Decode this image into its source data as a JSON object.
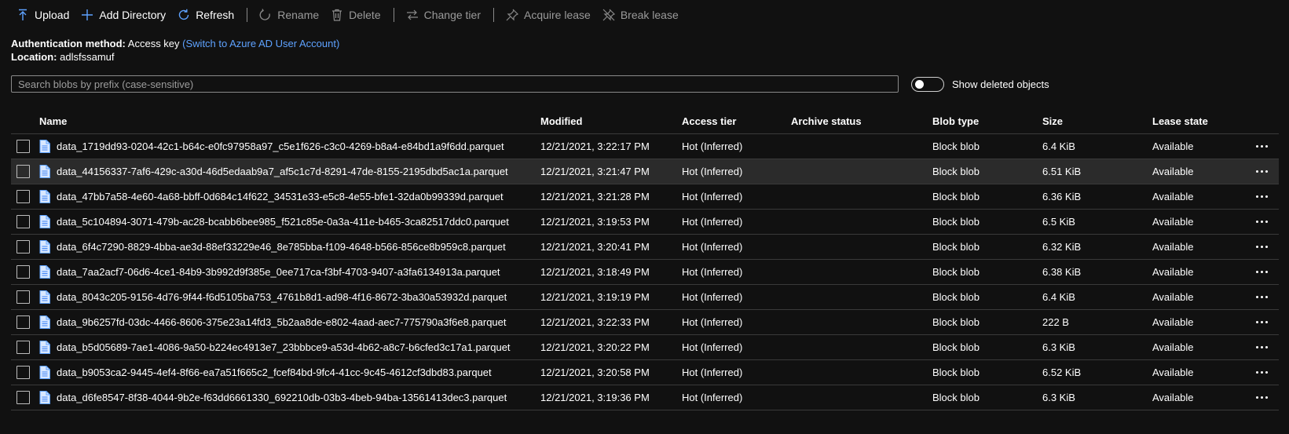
{
  "toolbar": {
    "upload": "Upload",
    "add_directory": "Add Directory",
    "refresh": "Refresh",
    "rename": "Rename",
    "delete": "Delete",
    "change_tier": "Change tier",
    "acquire_lease": "Acquire lease",
    "break_lease": "Break lease"
  },
  "info": {
    "auth_label": "Authentication method:",
    "auth_value": "Access key",
    "auth_link": "(Switch to Azure AD User Account)",
    "location_label": "Location:",
    "location_value": "adlsfssamuf"
  },
  "search": {
    "placeholder": "Search blobs by prefix (case-sensitive)",
    "value": ""
  },
  "show_deleted": {
    "label": "Show deleted objects",
    "on": false
  },
  "columns": {
    "name": "Name",
    "modified": "Modified",
    "access_tier": "Access tier",
    "archive_status": "Archive status",
    "blob_type": "Blob type",
    "size": "Size",
    "lease_state": "Lease state"
  },
  "rows": [
    {
      "name": "data_1719dd93-0204-42c1-b64c-e0fc97958a97_c5e1f626-c3c0-4269-b8a4-e84bd1a9f6dd.parquet",
      "modified": "12/21/2021, 3:22:17 PM",
      "tier": "Hot (Inferred)",
      "archive": "",
      "type": "Block blob",
      "size": "6.4 KiB",
      "lease": "Available"
    },
    {
      "name": "data_44156337-7af6-429c-a30d-46d5edaab9a7_af5c1c7d-8291-47de-8155-2195dbd5ac1a.parquet",
      "modified": "12/21/2021, 3:21:47 PM",
      "tier": "Hot (Inferred)",
      "archive": "",
      "type": "Block blob",
      "size": "6.51 KiB",
      "lease": "Available"
    },
    {
      "name": "data_47bb7a58-4e60-4a68-bbff-0d684c14f622_34531e33-e5c8-4e55-bfe1-32da0b99339d.parquet",
      "modified": "12/21/2021, 3:21:28 PM",
      "tier": "Hot (Inferred)",
      "archive": "",
      "type": "Block blob",
      "size": "6.36 KiB",
      "lease": "Available"
    },
    {
      "name": "data_5c104894-3071-479b-ac28-bcabb6bee985_f521c85e-0a3a-411e-b465-3ca82517ddc0.parquet",
      "modified": "12/21/2021, 3:19:53 PM",
      "tier": "Hot (Inferred)",
      "archive": "",
      "type": "Block blob",
      "size": "6.5 KiB",
      "lease": "Available"
    },
    {
      "name": "data_6f4c7290-8829-4bba-ae3d-88ef33229e46_8e785bba-f109-4648-b566-856ce8b959c8.parquet",
      "modified": "12/21/2021, 3:20:41 PM",
      "tier": "Hot (Inferred)",
      "archive": "",
      "type": "Block blob",
      "size": "6.32 KiB",
      "lease": "Available"
    },
    {
      "name": "data_7aa2acf7-06d6-4ce1-84b9-3b992d9f385e_0ee717ca-f3bf-4703-9407-a3fa6134913a.parquet",
      "modified": "12/21/2021, 3:18:49 PM",
      "tier": "Hot (Inferred)",
      "archive": "",
      "type": "Block blob",
      "size": "6.38 KiB",
      "lease": "Available"
    },
    {
      "name": "data_8043c205-9156-4d76-9f44-f6d5105ba753_4761b8d1-ad98-4f16-8672-3ba30a53932d.parquet",
      "modified": "12/21/2021, 3:19:19 PM",
      "tier": "Hot (Inferred)",
      "archive": "",
      "type": "Block blob",
      "size": "6.4 KiB",
      "lease": "Available"
    },
    {
      "name": "data_9b6257fd-03dc-4466-8606-375e23a14fd3_5b2aa8de-e802-4aad-aec7-775790a3f6e8.parquet",
      "modified": "12/21/2021, 3:22:33 PM",
      "tier": "Hot (Inferred)",
      "archive": "",
      "type": "Block blob",
      "size": "222 B",
      "lease": "Available"
    },
    {
      "name": "data_b5d05689-7ae1-4086-9a50-b224ec4913e7_23bbbce9-a53d-4b62-a8c7-b6cfed3c17a1.parquet",
      "modified": "12/21/2021, 3:20:22 PM",
      "tier": "Hot (Inferred)",
      "archive": "",
      "type": "Block blob",
      "size": "6.3 KiB",
      "lease": "Available"
    },
    {
      "name": "data_b9053ca2-9445-4ef4-8f66-ea7a51f665c2_fcef84bd-9fc4-41cc-9c45-4612cf3dbd83.parquet",
      "modified": "12/21/2021, 3:20:58 PM",
      "tier": "Hot (Inferred)",
      "archive": "",
      "type": "Block blob",
      "size": "6.52 KiB",
      "lease": "Available"
    },
    {
      "name": "data_d6fe8547-8f38-4044-9b2e-f63dd6661330_692210db-03b3-4beb-94ba-13561413dec3.parquet",
      "modified": "12/21/2021, 3:19:36 PM",
      "tier": "Hot (Inferred)",
      "archive": "",
      "type": "Block blob",
      "size": "6.3 KiB",
      "lease": "Available"
    }
  ],
  "selected_row": 1,
  "colors": {
    "accent": "#5ea2ff",
    "background": "#111111",
    "selected_row": "#2b2b2b",
    "disabled_text": "#9a9a9a"
  },
  "icons": {
    "upload": "upload-arrow-icon",
    "add_directory": "plus-icon",
    "refresh": "refresh-icon",
    "rename": "rename-icon",
    "delete": "trash-icon",
    "change_tier": "swap-arrows-icon",
    "acquire_lease": "pin-icon",
    "break_lease": "break-pin-icon",
    "file": "document-icon",
    "more": "ellipsis-icon"
  }
}
